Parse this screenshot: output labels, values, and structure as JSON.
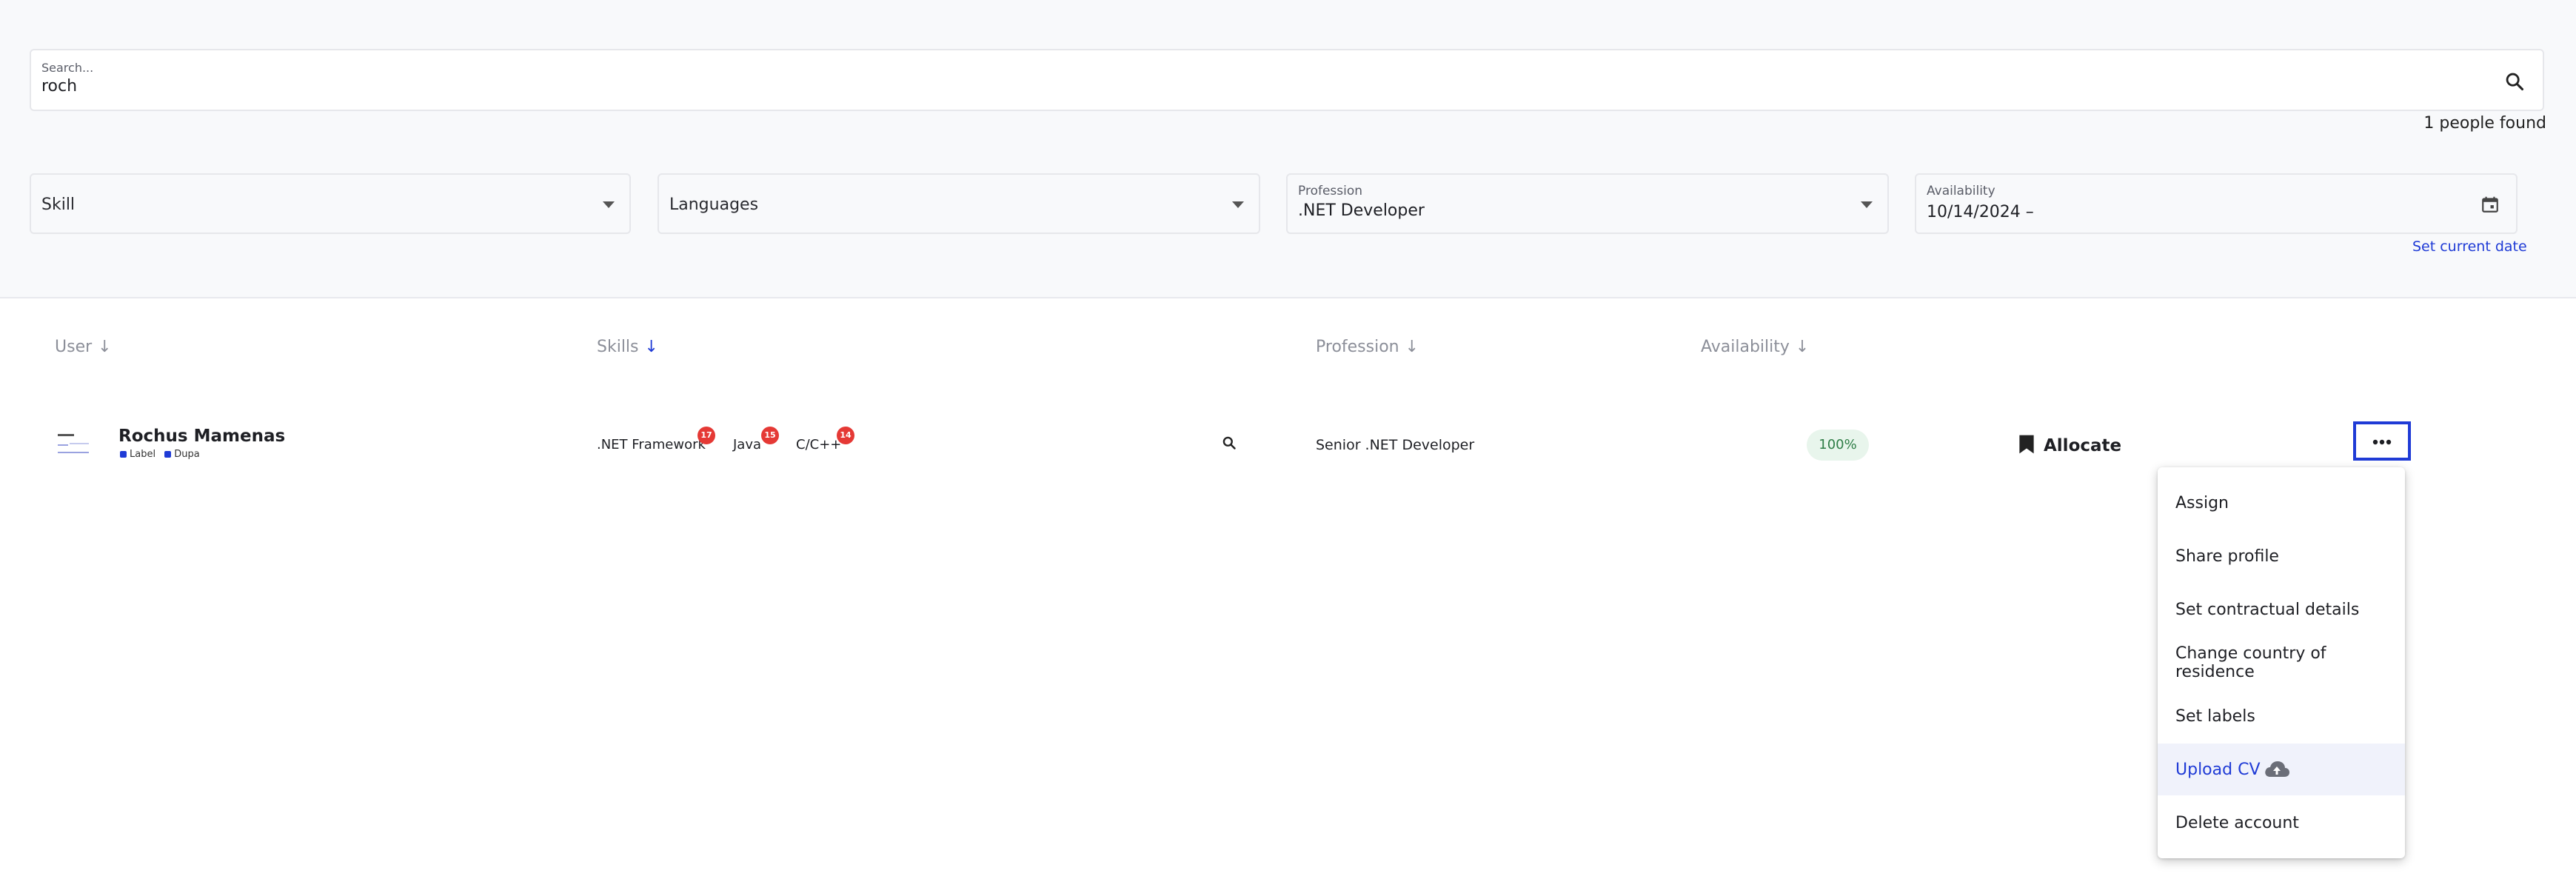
{
  "search": {
    "label": "Search...",
    "value": "roch"
  },
  "results_count": "1 people found",
  "filters": {
    "skill": {
      "placeholder": "Skill"
    },
    "languages": {
      "placeholder": "Languages"
    },
    "profession": {
      "label": "Profession",
      "value": ".NET Developer"
    },
    "availability": {
      "label": "Availability",
      "value": "10/14/2024 –"
    },
    "set_current_date": "Set current date"
  },
  "table": {
    "headers": {
      "user": "User",
      "skills": "Skills",
      "profession": "Profession",
      "availability": "Availability"
    },
    "rows": [
      {
        "name": "Rochus Mamenas",
        "labels": [
          "Label",
          "Dupa"
        ],
        "skills": [
          {
            "name": ".NET Framework",
            "count": "17"
          },
          {
            "name": "Java",
            "count": "15"
          },
          {
            "name": "C/C++",
            "count": "14"
          }
        ],
        "profession": "Senior .NET Developer",
        "availability": "100%",
        "allocate_label": "Allocate"
      }
    ]
  },
  "menu": {
    "items": [
      "Assign",
      "Share profile",
      "Set contractual details",
      "Change country of residence",
      "Set labels",
      "Upload CV",
      "Delete account"
    ]
  },
  "colors": {
    "accent": "#1f3bd6",
    "badge": "#e53935",
    "availability_bg": "#e8f5ec",
    "availability_text": "#2e7d46"
  }
}
